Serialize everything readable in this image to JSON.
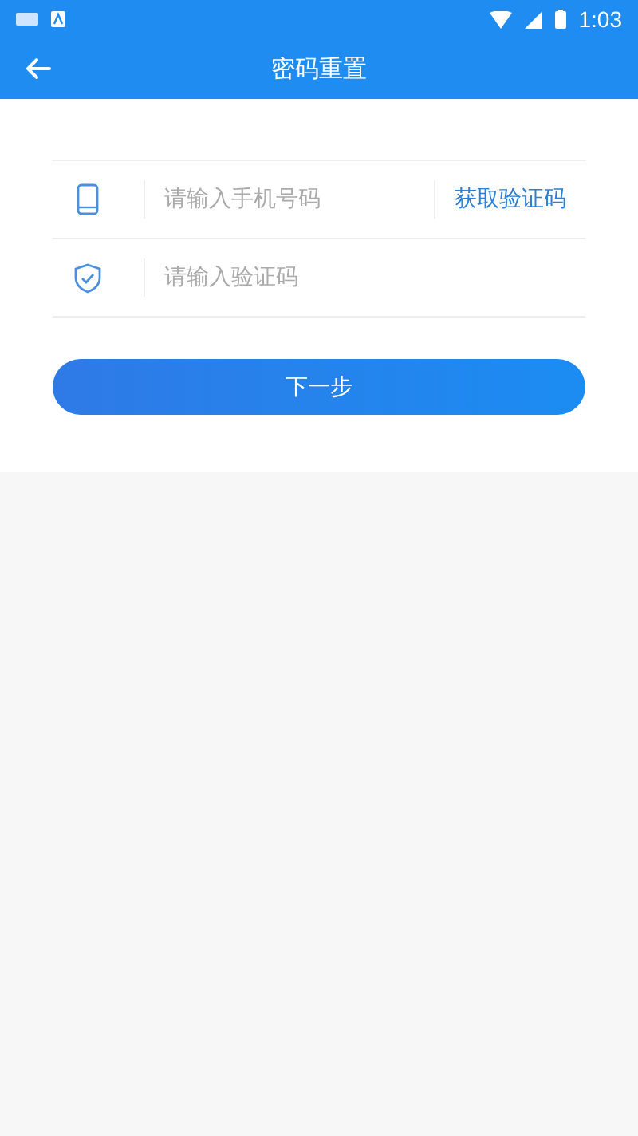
{
  "status_bar": {
    "time": "1:03"
  },
  "header": {
    "title": "密码重置"
  },
  "fields": [
    {
      "kind": "phone",
      "placeholder": "请输入手机号码",
      "action": "获取验证码"
    },
    {
      "kind": "code",
      "placeholder": "请输入验证码"
    }
  ],
  "submit": {
    "label": "下一步"
  }
}
